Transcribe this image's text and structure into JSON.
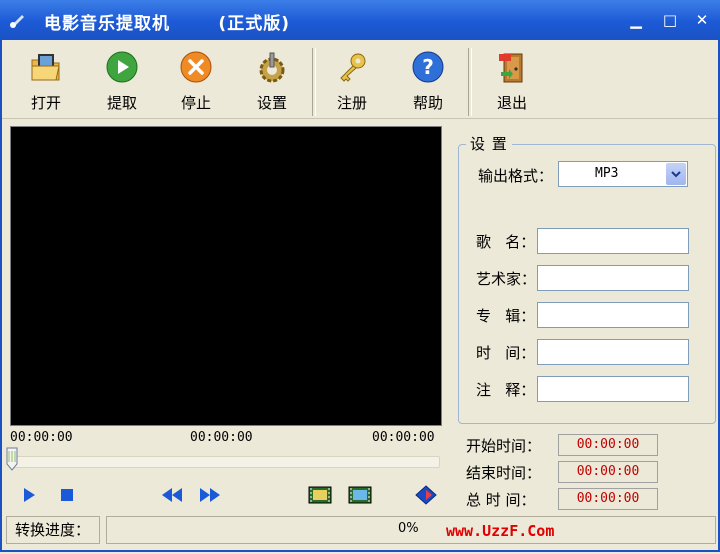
{
  "window": {
    "title": "电影音乐提取机       (正式版)",
    "minimize": "▁",
    "maximize": "□",
    "close": "✕"
  },
  "toolbar": {
    "open": "打开",
    "extract": "提取",
    "stop": "停止",
    "settings": "设置",
    "register": "注册",
    "help": "帮助",
    "exit": "退出"
  },
  "player": {
    "time_start": "00:00:00",
    "time_mid": "00:00:00",
    "time_end": "00:00:00",
    "position": 0
  },
  "settings": {
    "group_title": "设 置",
    "format_label": "输出格式：",
    "format_value": "MP3",
    "song_label": "歌   名：",
    "artist_label": "艺术家：",
    "album_label": "专   辑：",
    "time_label": "时   间：",
    "comment_label": "注   释：",
    "song": "",
    "artist": "",
    "album": "",
    "time": "",
    "comment": ""
  },
  "times": {
    "start_label": "开始时间：",
    "start_value": "00:00:00",
    "end_label": "结束时间：",
    "end_value": "00:00:00",
    "total_label": "总 时 间：",
    "total_value": "00:00:00"
  },
  "status": {
    "progress_label": "转换进度：",
    "progress_text": "0%",
    "progress": 0,
    "watermark": "www.UzzF.Com"
  }
}
